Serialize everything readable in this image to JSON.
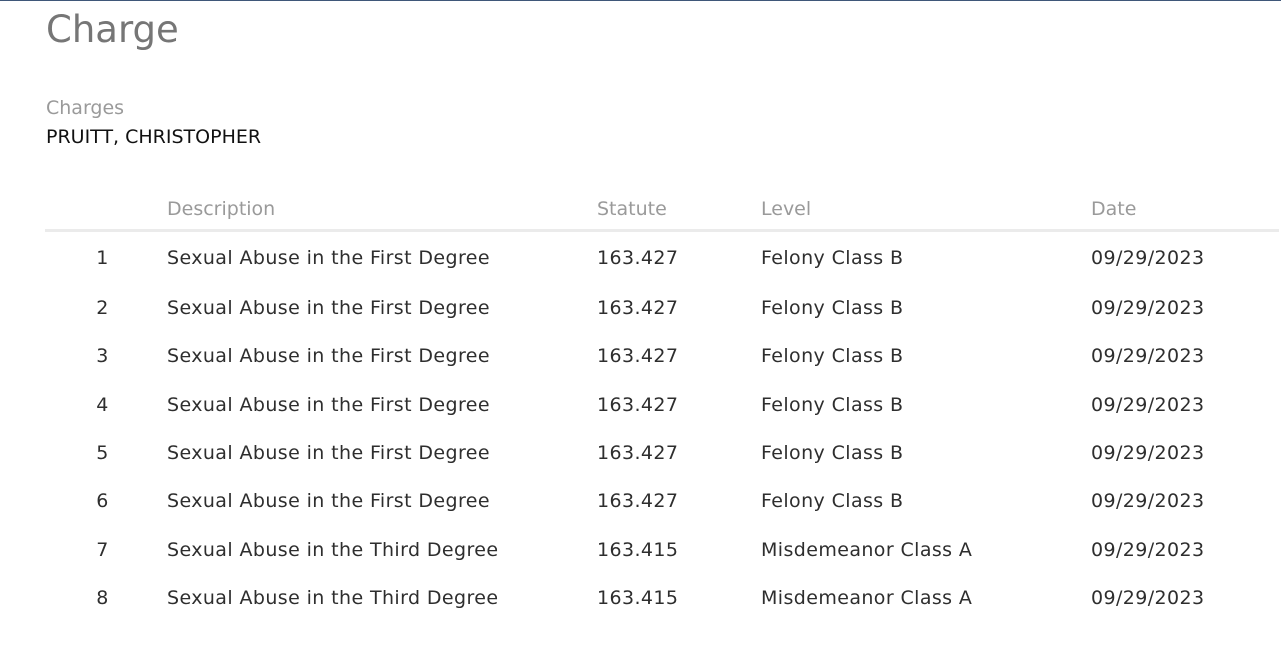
{
  "page": {
    "title": "Charge",
    "section_label": "Charges",
    "defendant": "PRUITT, CHRISTOPHER"
  },
  "table": {
    "headers": {
      "number": "",
      "description": "Description",
      "statute": "Statute",
      "level": "Level",
      "date": "Date"
    },
    "rows": [
      {
        "number": "1",
        "description": "Sexual Abuse in the First Degree",
        "statute": "163.427",
        "level": "Felony Class B",
        "date": "09/29/2023"
      },
      {
        "number": "2",
        "description": "Sexual Abuse in the First Degree",
        "statute": "163.427",
        "level": "Felony Class B",
        "date": "09/29/2023"
      },
      {
        "number": "3",
        "description": "Sexual Abuse in the First Degree",
        "statute": "163.427",
        "level": "Felony Class B",
        "date": "09/29/2023"
      },
      {
        "number": "4",
        "description": "Sexual Abuse in the First Degree",
        "statute": "163.427",
        "level": "Felony Class B",
        "date": "09/29/2023"
      },
      {
        "number": "5",
        "description": "Sexual Abuse in the First Degree",
        "statute": "163.427",
        "level": "Felony Class B",
        "date": "09/29/2023"
      },
      {
        "number": "6",
        "description": "Sexual Abuse in the First Degree",
        "statute": "163.427",
        "level": "Felony Class B",
        "date": "09/29/2023"
      },
      {
        "number": "7",
        "description": "Sexual Abuse in the Third Degree",
        "statute": "163.415",
        "level": "Misdemeanor Class A",
        "date": "09/29/2023"
      },
      {
        "number": "8",
        "description": "Sexual Abuse in the Third Degree",
        "statute": "163.415",
        "level": "Misdemeanor Class A",
        "date": "09/29/2023"
      }
    ]
  },
  "colors": {
    "top_border": "#3f5779",
    "title": "#767676",
    "muted_label": "#9a9a9a",
    "body_text": "#2e2e2e",
    "header_rule": "#ebebeb"
  }
}
